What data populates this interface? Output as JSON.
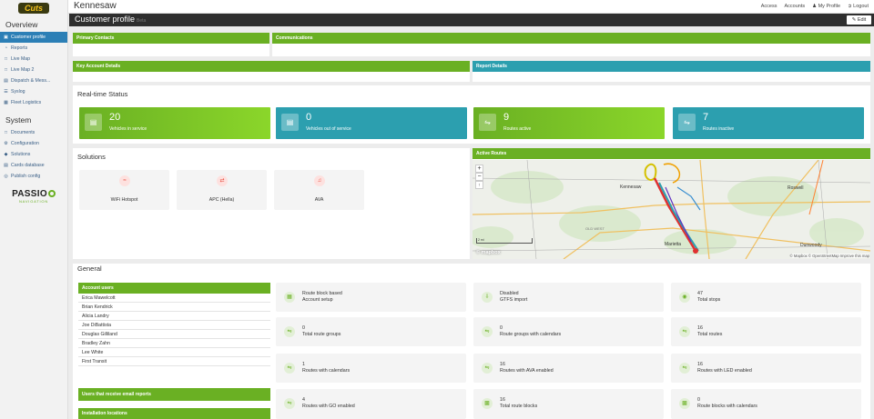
{
  "topbar": {
    "title": "Kennesaw",
    "links": [
      "Access",
      "Accounts",
      "My Profile",
      "Logout"
    ]
  },
  "logo": {
    "text": "Cuts"
  },
  "sidebar": {
    "overview_label": "Overview",
    "system_label": "System",
    "overview_items": [
      {
        "label": "Customer profile",
        "icon": "id-card-icon",
        "active": true
      },
      {
        "label": "Reports",
        "icon": "chart-icon"
      },
      {
        "label": "Live Map",
        "icon": "map-icon"
      },
      {
        "label": "Live Map 2",
        "icon": "map-icon"
      },
      {
        "label": "Dispatch & Mess...",
        "icon": "bus-icon"
      },
      {
        "label": "Syslog",
        "icon": "list-icon"
      },
      {
        "label": "Fleet Logistics",
        "icon": "grid-icon"
      }
    ],
    "system_items": [
      {
        "label": "Documents",
        "icon": "document-icon"
      },
      {
        "label": "Configuration",
        "icon": "cogs-icon"
      },
      {
        "label": "Solutions",
        "icon": "puzzle-icon"
      },
      {
        "label": "Cards database",
        "icon": "card-icon"
      },
      {
        "label": "Publish config",
        "icon": "globe-icon"
      }
    ],
    "brand": {
      "name": "PASSIO",
      "tagline": "NAVIGATION"
    }
  },
  "header": {
    "title": "Customer profile",
    "subtitle": "Beta",
    "edit_label": "Edit"
  },
  "panels": {
    "primary_contacts": "Primary Contacts",
    "communications": "Communications",
    "key_account": "Key Account Details",
    "report_details": "Report Details"
  },
  "realtime": {
    "title": "Real-time Status",
    "cards": [
      {
        "value": "20",
        "label": "Vehicles in service",
        "style": "green",
        "icon": "bus-icon"
      },
      {
        "value": "0",
        "label": "Vehicles out of service",
        "style": "teal",
        "icon": "bus-icon"
      },
      {
        "value": "9",
        "label": "Routes active",
        "style": "green",
        "icon": "route-icon"
      },
      {
        "value": "7",
        "label": "Routes inactive",
        "style": "teal",
        "icon": "route-icon"
      }
    ]
  },
  "solutions": {
    "title": "Solutions",
    "items": [
      {
        "label": "WiFi Hotspot",
        "icon": "wifi-icon"
      },
      {
        "label": "APC (Hella)",
        "icon": "swap-icon"
      },
      {
        "label": "AVA",
        "icon": "speaker-icon"
      }
    ]
  },
  "map": {
    "title": "Active Routes",
    "labels": [
      "Kennesaw",
      "Roswell",
      "Marietta",
      "Dunwoody",
      "OLD WEST"
    ],
    "scale": "2 mi",
    "attribution": "© Mapbox © OpenStreetMap Improve this map",
    "mapbox": "© mapbox"
  },
  "general": {
    "title": "General",
    "account_users_title": "Account users",
    "users": [
      "Erica Mawelcott",
      "Brian Kendrick",
      "Alicia Landry",
      "Joe DiBattista",
      "Douglas Gilliland",
      "Bradley Zahn",
      "Lee White",
      "First Transit"
    ],
    "email_reports_title": "Users that receive email reports",
    "installation_title": "Installation locations",
    "cards": [
      {
        "value": "Route block based",
        "label": "Account setup",
        "icon": "setup-icon"
      },
      {
        "value": "Disabled",
        "label": "GTFS import",
        "icon": "import-icon"
      },
      {
        "value": "47",
        "label": "Total stops",
        "icon": "stop-icon"
      },
      {
        "value": "0",
        "label": "Total route groups",
        "icon": "route-icon"
      },
      {
        "value": "0",
        "label": "Route groups with calendars",
        "icon": "route-icon"
      },
      {
        "value": "16",
        "label": "Total routes",
        "icon": "route-icon"
      },
      {
        "value": "1",
        "label": "Routes with calendars",
        "icon": "route-icon"
      },
      {
        "value": "16",
        "label": "Routes with AVA enabled",
        "icon": "route-icon"
      },
      {
        "value": "16",
        "label": "Routes with LED enabled",
        "icon": "route-icon"
      },
      {
        "value": "4",
        "label": "Routes with GO enabled",
        "icon": "route-icon"
      },
      {
        "value": "16",
        "label": "Total route blocks",
        "icon": "block-icon"
      },
      {
        "value": "0",
        "label": "Route blocks with calendars",
        "icon": "block-icon"
      }
    ]
  },
  "colors": {
    "green": "#6ab023",
    "teal": "#2c9faf",
    "dark": "#2e2e2e",
    "active": "#2c7fb6"
  }
}
